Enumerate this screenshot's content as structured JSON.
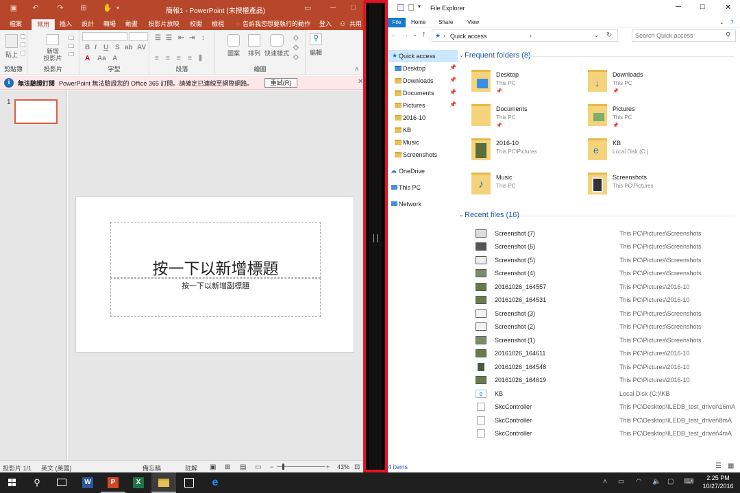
{
  "colors": {
    "ppt_accent": "#b7472a",
    "fe_accent": "#1979ca",
    "highlight": "#e81123"
  },
  "ppt": {
    "title": "簡報1 - PowerPoint (未授權產品)",
    "tabs": [
      "檔案",
      "常用",
      "插入",
      "設計",
      "轉場",
      "動畫",
      "投影片放映",
      "校閱",
      "檢視"
    ],
    "tell_me": "告訴我您想要執行的動作",
    "signin": "登入",
    "share": "共用",
    "ribbon": {
      "clipboard": "剪貼簿",
      "paste": "貼上",
      "slides": "投影片",
      "new_slide": "新增\n投影片",
      "font": "字型",
      "paragraph": "段落",
      "drawing": "繪圖",
      "shapes": "圖案",
      "arrange": "排列",
      "quick_styles": "快速樣式",
      "editing": "編輯"
    },
    "infobar": {
      "bold": "無法驗證訂閱",
      "message": "PowerPoint 無法驗證您的 Office 365 訂閱。請確定已連線至網際網路。",
      "retry": "重試(R)"
    },
    "thumb_number": "1",
    "slide_title": "按一下以新增標題",
    "slide_subtitle": "按一下以新增副標題",
    "status": {
      "slide": "投影片 1/1",
      "lang": "英文 (美國)",
      "notes": "備忘稿",
      "comments": "註解",
      "zoom": "43%"
    }
  },
  "fe": {
    "title": "File Explorer",
    "tabs": [
      "File",
      "Home",
      "Share",
      "View"
    ],
    "address": "Quick access",
    "search_placeholder": "Search Quick access",
    "nav": [
      {
        "label": "Quick access",
        "pinned": false
      },
      {
        "label": "Desktop",
        "pinned": true
      },
      {
        "label": "Downloads",
        "pinned": true
      },
      {
        "label": "Documents",
        "pinned": true
      },
      {
        "label": "Pictures",
        "pinned": true
      },
      {
        "label": "2016-10",
        "pinned": false
      },
      {
        "label": "KB",
        "pinned": false
      },
      {
        "label": "Music",
        "pinned": false
      },
      {
        "label": "Screenshots",
        "pinned": false
      },
      {
        "label": "OneDrive",
        "pinned": false
      },
      {
        "label": "This PC",
        "pinned": false
      },
      {
        "label": "Network",
        "pinned": false
      }
    ],
    "frequent_header": "Frequent folders (8)",
    "frequent": [
      {
        "name": "Desktop",
        "sub": "This PC",
        "pinned": true
      },
      {
        "name": "Downloads",
        "sub": "This PC",
        "pinned": true
      },
      {
        "name": "Documents",
        "sub": "This PC",
        "pinned": true
      },
      {
        "name": "Pictures",
        "sub": "This PC",
        "pinned": true
      },
      {
        "name": "2016-10",
        "sub": "This PC\\Pictures",
        "pinned": false
      },
      {
        "name": "KB",
        "sub": "Local Disk (C:)",
        "pinned": false
      },
      {
        "name": "Music",
        "sub": "This PC",
        "pinned": false
      },
      {
        "name": "Screenshots",
        "sub": "This PC\\Pictures",
        "pinned": false
      }
    ],
    "recent_header": "Recent files (16)",
    "recent": [
      {
        "name": "Screenshot (7)",
        "path": "This PC\\Pictures\\Screenshots"
      },
      {
        "name": "Screenshot (6)",
        "path": "This PC\\Pictures\\Screenshots"
      },
      {
        "name": "Screenshot (5)",
        "path": "This PC\\Pictures\\Screenshots"
      },
      {
        "name": "Screenshot (4)",
        "path": "This PC\\Pictures\\Screenshots"
      },
      {
        "name": "20161026_164557",
        "path": "This PC\\Pictures\\2016-10"
      },
      {
        "name": "20161026_164531",
        "path": "This PC\\Pictures\\2016-10"
      },
      {
        "name": "Screenshot (3)",
        "path": "This PC\\Pictures\\Screenshots"
      },
      {
        "name": "Screenshot (2)",
        "path": "This PC\\Pictures\\Screenshots"
      },
      {
        "name": "Screenshot (1)",
        "path": "This PC\\Pictures\\Screenshots"
      },
      {
        "name": "20161026_164611",
        "path": "This PC\\Pictures\\2016-10"
      },
      {
        "name": "20161026_164548",
        "path": "This PC\\Pictures\\2016-10"
      },
      {
        "name": "20161026_164619",
        "path": "This PC\\Pictures\\2016-10"
      },
      {
        "name": "KB",
        "path": "Local Disk (C:)\\KB"
      },
      {
        "name": "SkcController",
        "path": "This PC\\Desktop\\ILEDB_test_driver\\16mA"
      },
      {
        "name": "SkcController",
        "path": "This PC\\Desktop\\ILEDB_test_driver\\8mA"
      },
      {
        "name": "SkcController",
        "path": "This PC\\Desktop\\ILEDB_test_driver\\4mA"
      }
    ],
    "status": "4 items"
  },
  "taskbar": {
    "time": "2:25 PM",
    "date": "10/27/2016"
  }
}
